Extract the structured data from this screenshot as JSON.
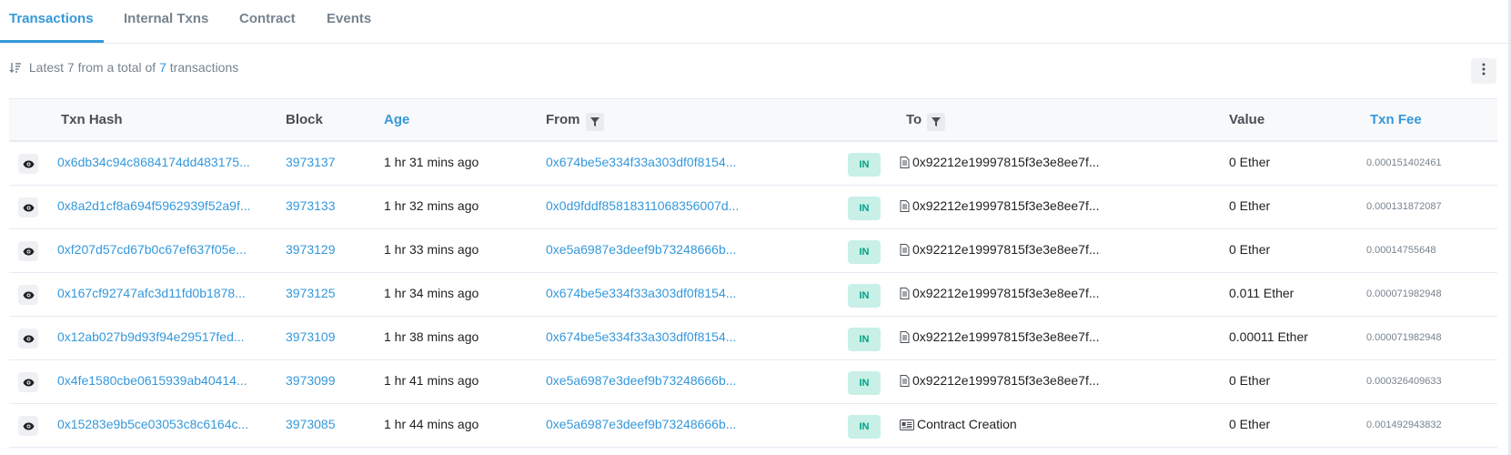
{
  "tabs": [
    {
      "label": "Transactions",
      "active": true
    },
    {
      "label": "Internal Txns",
      "active": false
    },
    {
      "label": "Contract",
      "active": false
    },
    {
      "label": "Events",
      "active": false
    }
  ],
  "summary": {
    "prefix": "Latest 7 from a total of",
    "count": "7",
    "suffix": "transactions"
  },
  "table": {
    "headers": {
      "hash": "Txn Hash",
      "block": "Block",
      "age": "Age",
      "from": "From",
      "to": "To",
      "value": "Value",
      "fee": "Txn Fee"
    },
    "rows": [
      {
        "hash": "0x6db34c94c8684174dd483175...",
        "block": "3973137",
        "age": "1 hr 31 mins ago",
        "from": "0x674be5e334f33a303df0f8154...",
        "direction": "IN",
        "to": "0x92212e19997815f3e3e8ee7f...",
        "to_icon": "contract-doc-icon",
        "value": "0 Ether",
        "fee": "0.000151402461"
      },
      {
        "hash": "0x8a2d1cf8a694f5962939f52a9f...",
        "block": "3973133",
        "age": "1 hr 32 mins ago",
        "from": "0x0d9fddf85818311068356007d...",
        "direction": "IN",
        "to": "0x92212e19997815f3e3e8ee7f...",
        "to_icon": "contract-doc-icon",
        "value": "0 Ether",
        "fee": "0.000131872087"
      },
      {
        "hash": "0xf207d57cd67b0c67ef637f05e...",
        "block": "3973129",
        "age": "1 hr 33 mins ago",
        "from": "0xe5a6987e3deef9b73248666b...",
        "direction": "IN",
        "to": "0x92212e19997815f3e3e8ee7f...",
        "to_icon": "contract-doc-icon",
        "value": "0 Ether",
        "fee": "0.00014755648"
      },
      {
        "hash": "0x167cf92747afc3d11fd0b1878...",
        "block": "3973125",
        "age": "1 hr 34 mins ago",
        "from": "0x674be5e334f33a303df0f8154...",
        "direction": "IN",
        "to": "0x92212e19997815f3e3e8ee7f...",
        "to_icon": "contract-doc-icon",
        "value": "0.011 Ether",
        "fee": "0.000071982948"
      },
      {
        "hash": "0x12ab027b9d93f94e29517fed...",
        "block": "3973109",
        "age": "1 hr 38 mins ago",
        "from": "0x674be5e334f33a303df0f8154...",
        "direction": "IN",
        "to": "0x92212e19997815f3e3e8ee7f...",
        "to_icon": "contract-doc-icon",
        "value": "0.00011 Ether",
        "fee": "0.000071982948"
      },
      {
        "hash": "0x4fe1580cbe0615939ab40414...",
        "block": "3973099",
        "age": "1 hr 41 mins ago",
        "from": "0xe5a6987e3deef9b73248666b...",
        "direction": "IN",
        "to": "0x92212e19997815f3e3e8ee7f...",
        "to_icon": "contract-doc-icon",
        "value": "0 Ether",
        "fee": "0.000326409633"
      },
      {
        "hash": "0x15283e9b5ce03053c8c6164c...",
        "block": "3973085",
        "age": "1 hr 44 mins ago",
        "from": "0xe5a6987e3deef9b73248666b...",
        "direction": "IN",
        "to": "Contract Creation",
        "to_icon": "contract-creation-icon",
        "value": "0 Ether",
        "fee": "0.001492943832"
      }
    ]
  },
  "colors": {
    "accent": "#3498db",
    "in_badge_bg": "#c8f0e6",
    "in_badge_text": "#00a186",
    "muted": "#77838f"
  }
}
